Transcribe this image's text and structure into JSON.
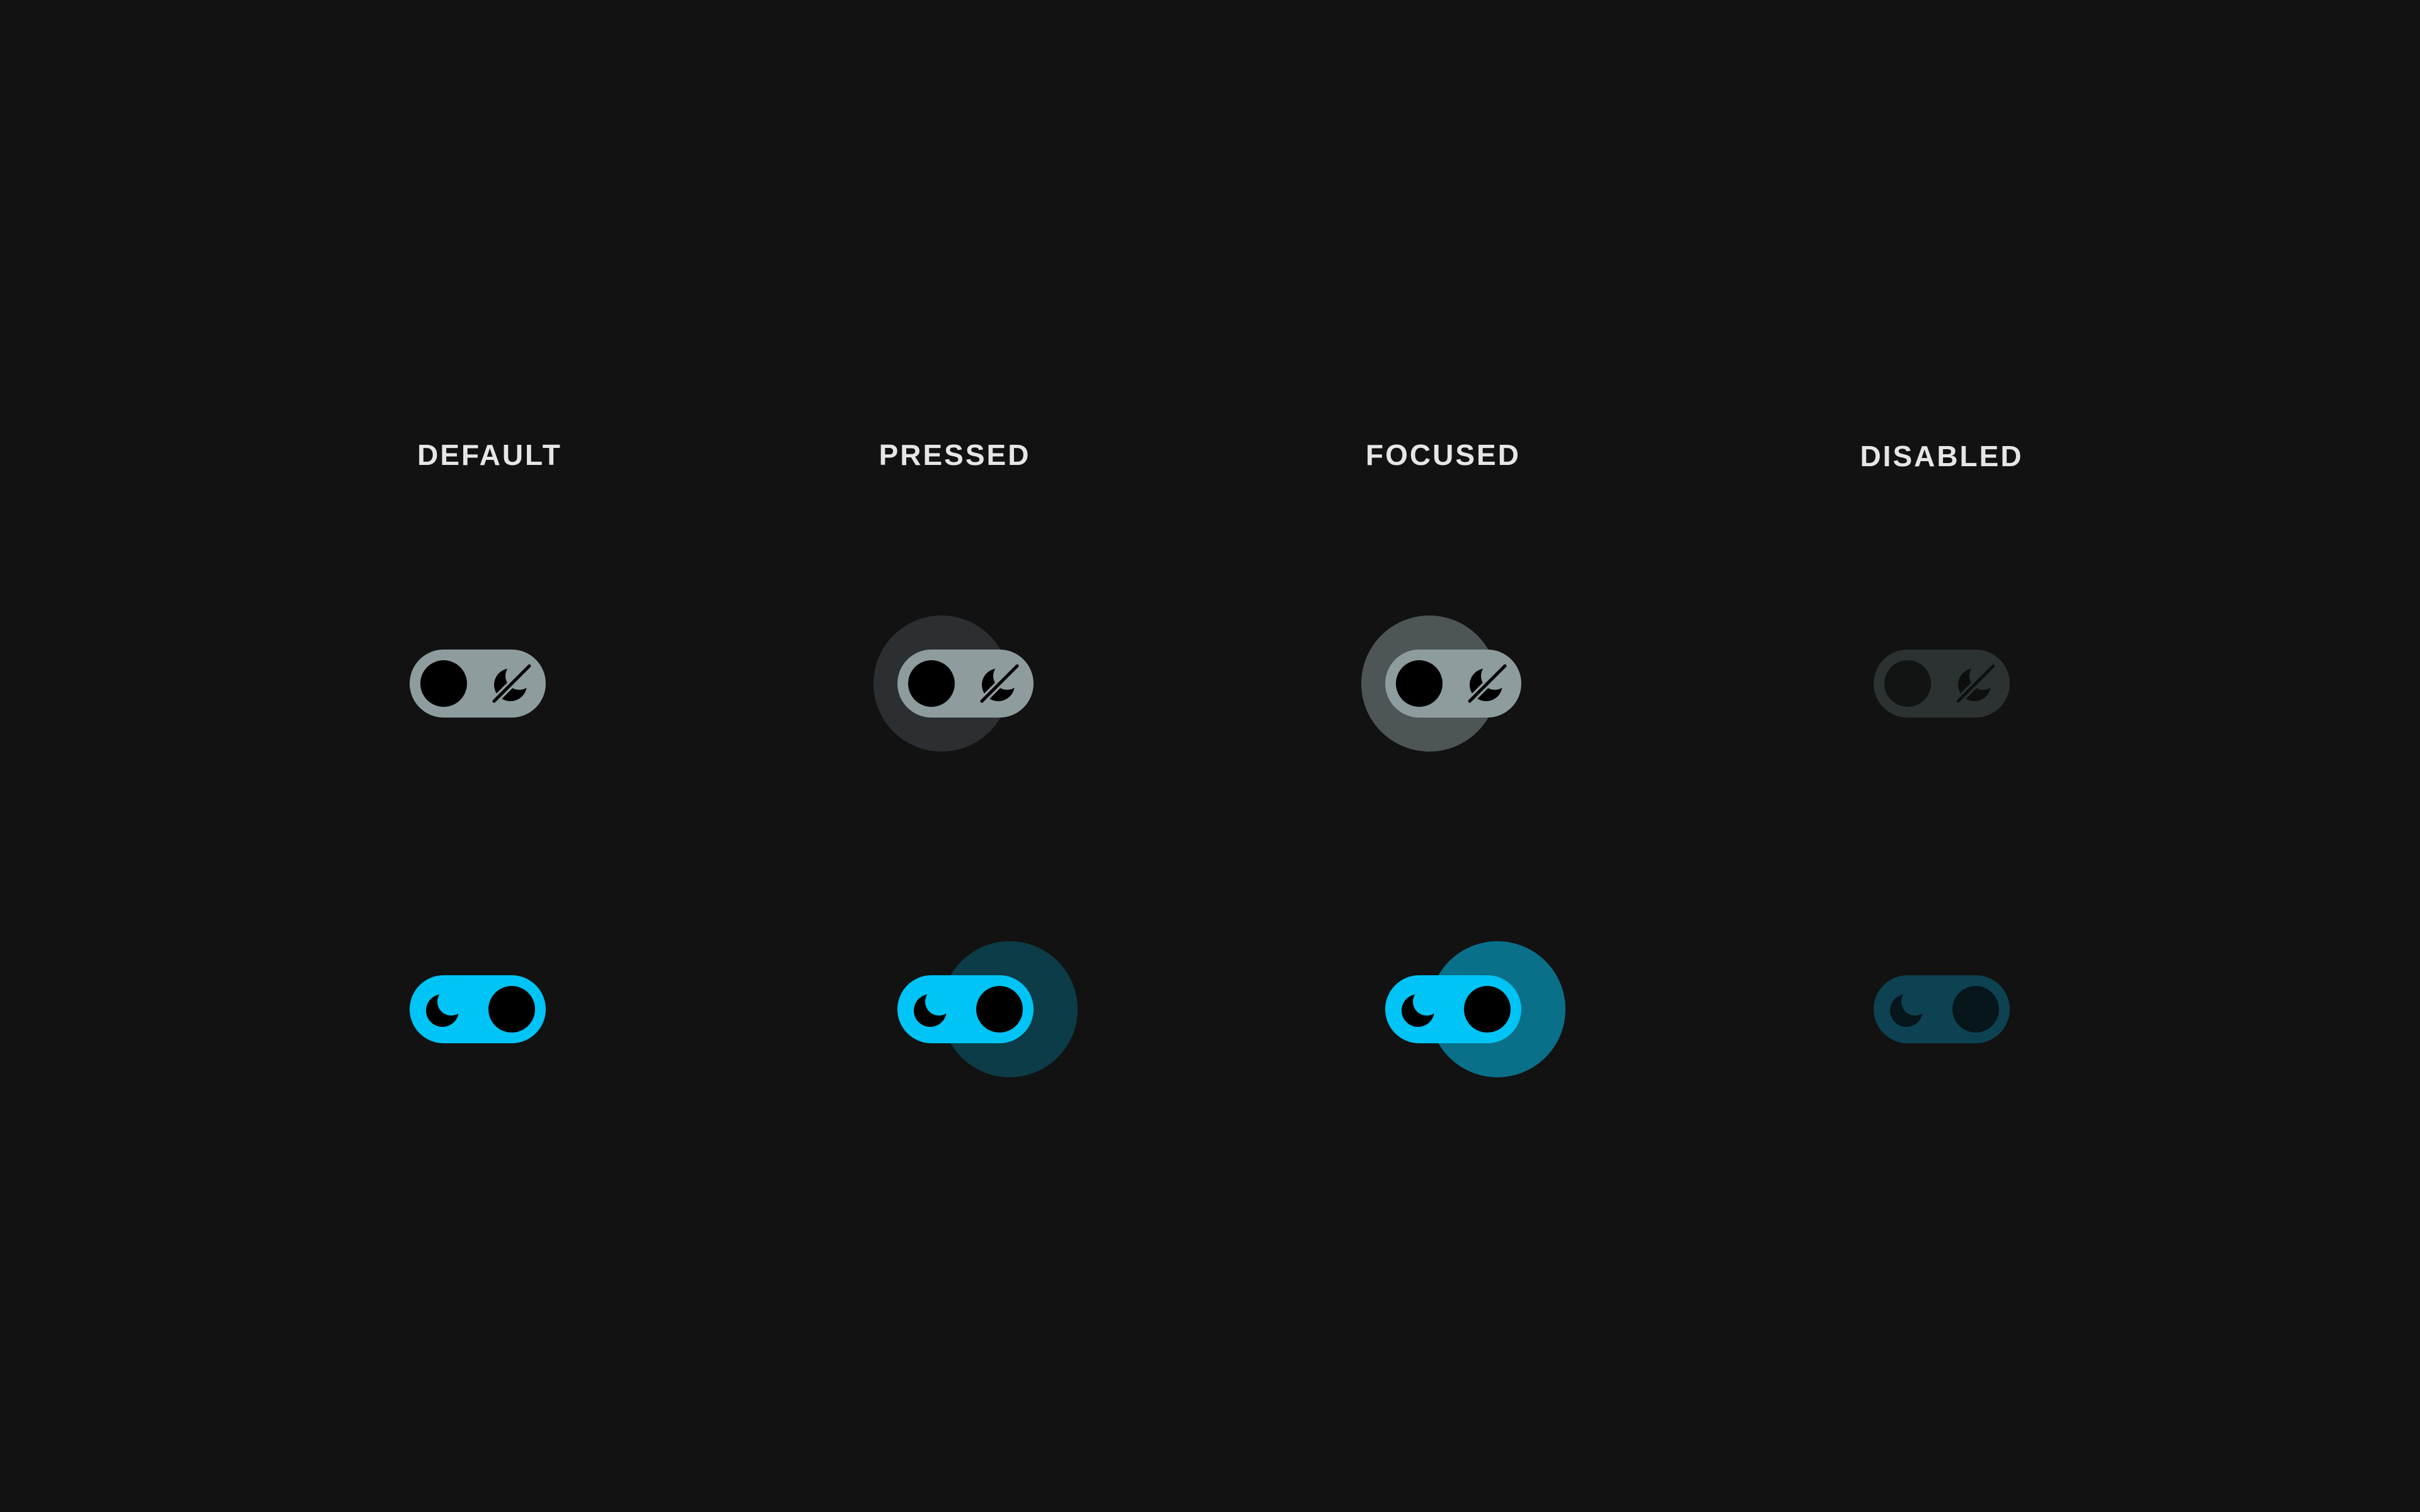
{
  "columns": [
    {
      "id": "default",
      "label": "DEFAULT"
    },
    {
      "id": "pressed",
      "label": "PRESSED"
    },
    {
      "id": "focused",
      "label": "FOCUSED"
    },
    {
      "id": "disabled",
      "label": "DISABLED"
    }
  ],
  "rows": [
    {
      "id": "off",
      "checked": false,
      "icon": "no-moon-icon"
    },
    {
      "id": "on",
      "checked": true,
      "icon": "moon-icon"
    }
  ],
  "colors": {
    "background": "#121212",
    "label": "#e6e6e6",
    "track_off": "#8e9c9e",
    "track_on": "#00c4f5",
    "thumb": "#000000",
    "halo_pressed_off": "#2b2f31",
    "halo_focused_off": "#4d5557",
    "halo_pressed_on": "#0b3c47",
    "halo_focused_on": "#0a7089",
    "track_disabled_off": "#2c3132",
    "track_disabled_on": "#0d4252"
  }
}
